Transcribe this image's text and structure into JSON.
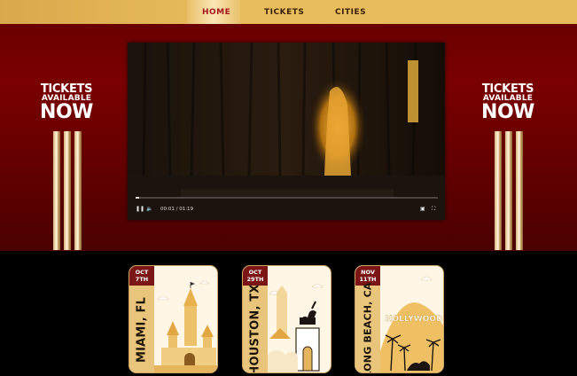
{
  "nav": {
    "items": [
      "HOME",
      "TICKETS",
      "CITIES"
    ],
    "active": "HOME"
  },
  "promo": {
    "line1": "TICKETS",
    "line2": "AVAILABLE",
    "line3": "NOW"
  },
  "video": {
    "time": "00:01 / 01:19",
    "progress": 0.013
  },
  "cards": [
    {
      "date_line1": "OCT",
      "date_line2": "7TH",
      "city": "MIAMI, FL"
    },
    {
      "date_line1": "OCT",
      "date_line2": "29TH",
      "city": "HOUSTON, TX"
    },
    {
      "date_line1": "NOV",
      "date_line2": "11TH",
      "city": "LONG BEACH, CA",
      "sign": "HOLLYWOOD"
    }
  ],
  "colors": {
    "nav_bg": "#e8bd5c",
    "hero_red": "#7a0000",
    "active_link": "#a4141c",
    "date_badge": "#7c1616",
    "card_strip": "#e9c57c"
  }
}
